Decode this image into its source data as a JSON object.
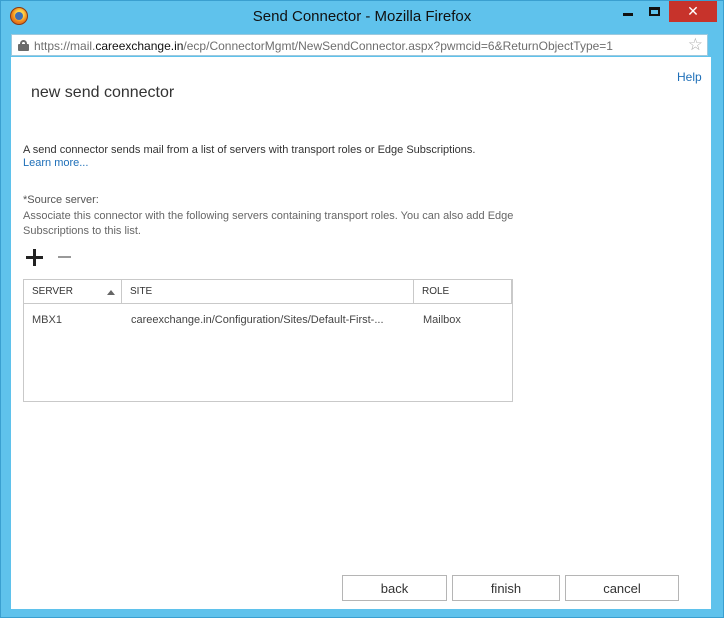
{
  "window": {
    "title": "Send Connector - Mozilla Firefox",
    "close_label": "✕"
  },
  "urlbar": {
    "url_prefix": "https://mail.",
    "url_domain": "careexchange.in",
    "url_path": "/ecp/ConnectorMgmt/NewSendConnector.aspx?pwmcid=6&ReturnObjectType=1"
  },
  "page": {
    "help_label": "Help",
    "title": "new send connector",
    "description": "A send connector sends mail from a list of servers with transport roles or Edge Subscriptions.",
    "learn_more": "Learn more...",
    "source_server_label": "*Source server:",
    "source_server_description": "Associate this connector with the following servers containing transport roles. You can also add Edge Subscriptions to this list."
  },
  "grid": {
    "columns": [
      "SERVER",
      "SITE",
      "ROLE"
    ],
    "rows": [
      {
        "server": "MBX1",
        "site": "careexchange.in/Configuration/Sites/Default-First-...",
        "role": "Mailbox"
      }
    ]
  },
  "footer": {
    "back_label": "back",
    "finish_label": "finish",
    "cancel_label": "cancel"
  },
  "icons": {
    "browser": "firefox-icon",
    "lock": "lock-icon",
    "bookmark": "star-icon",
    "add": "add-icon",
    "remove": "remove-icon",
    "sort": "sort-ascending-icon"
  },
  "colors": {
    "window_frame": "#5fc2ec",
    "link": "#1e6fb8",
    "close_button": "#c7332b"
  }
}
